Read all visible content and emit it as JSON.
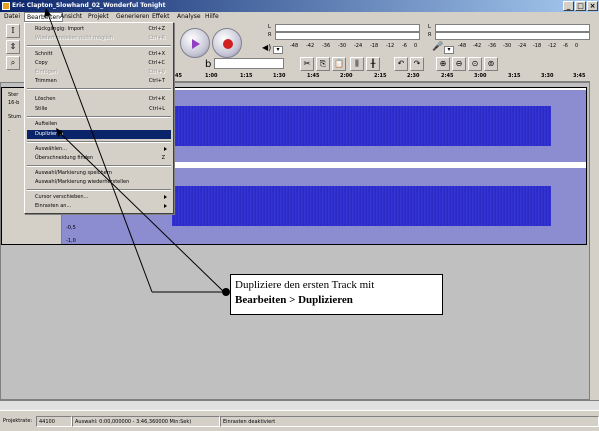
{
  "window": {
    "title": "Eric Clapton_Slowhand_02_Wonderful Tonight",
    "btn_min": "_",
    "btn_max": "□",
    "btn_close": "×"
  },
  "menubar": {
    "items": [
      "Datei",
      "Bearbeiten",
      "Ansicht",
      "Projekt",
      "Generieren",
      "Effekt",
      "Analyse",
      "Hilfe"
    ]
  },
  "meters": {
    "left_label": "L",
    "right_label": "R",
    "out_ticks": [
      "-48",
      "-42",
      "-36",
      "-30",
      "-24",
      "-18",
      "-12",
      "-6",
      "0"
    ],
    "in_ticks": [
      "-48",
      "-42",
      "-36",
      "-30",
      "-24",
      "-18",
      "-12",
      "-6",
      "0"
    ]
  },
  "ruler": {
    "ticks": [
      "45",
      "1:00",
      "1:15",
      "1:30",
      "1:45",
      "2:00",
      "2:15",
      "2:30",
      "2:45",
      "3:00",
      "3:15",
      "3:30",
      "3:45"
    ]
  },
  "tracks": {
    "info_partial": [
      "Ster",
      "16-b",
      "Stum",
      "-"
    ],
    "scale_labels": [
      "-0,5",
      "-1,0"
    ]
  },
  "edit_menu": {
    "items": [
      {
        "label": "Rückgängig: Import",
        "shortcut": "Ctrl+Z",
        "disabled": false
      },
      {
        "label": "Wiederherstellen nicht möglich",
        "shortcut": "Ctrl+R",
        "disabled": true
      },
      {
        "label": "Schnitt",
        "shortcut": "Ctrl+X",
        "disabled": false
      },
      {
        "label": "Copy",
        "shortcut": "Ctrl+C",
        "disabled": false
      },
      {
        "label": "Einfügen",
        "shortcut": "Ctrl+V",
        "disabled": true
      },
      {
        "label": "Trimmen",
        "shortcut": "Ctrl+T",
        "disabled": false
      },
      {
        "label": "Löschen",
        "shortcut": "Ctrl+K",
        "disabled": false
      },
      {
        "label": "Stille",
        "shortcut": "Ctrl+L",
        "disabled": false
      },
      {
        "label": "Aufteilen",
        "shortcut": "",
        "disabled": false
      },
      {
        "label": "Duplizieren",
        "shortcut": "",
        "disabled": false,
        "selected": true
      },
      {
        "label": "Auswählen...",
        "shortcut": "",
        "disabled": false,
        "submenu": true
      },
      {
        "label": "Überschneidung finden",
        "shortcut": "Z",
        "disabled": false
      },
      {
        "label": "Auswahl/Markierung speichern",
        "shortcut": "",
        "disabled": false
      },
      {
        "label": "Auswahl/Markierung wiederherstellen",
        "shortcut": "",
        "disabled": false
      },
      {
        "label": "Cursor verschieben...",
        "shortcut": "",
        "disabled": false,
        "submenu": true
      },
      {
        "label": "Einrasten an...",
        "shortcut": "",
        "disabled": false,
        "submenu": true
      }
    ]
  },
  "callout": {
    "line1": "Dupliziere den ersten Track mit",
    "line2": "Bearbeiten > Duplizieren"
  },
  "statusbar": {
    "rate_label": "Projektrate:",
    "rate_value": "44100",
    "selection": "Auswahl: 0:00,000000 - 3:46,360000 Min:Sek)",
    "snap": "Einrasten deaktiviert"
  },
  "colors": {
    "waveform": "#2828c8",
    "wave_bg": "#8c8cd0",
    "menu_highlight": "#0a246a",
    "titlebar": "#0a246a"
  }
}
